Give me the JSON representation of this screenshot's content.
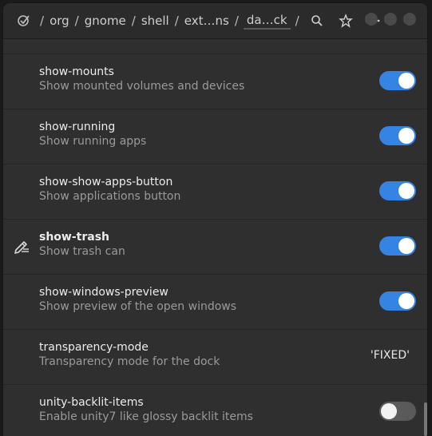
{
  "header": {
    "breadcrumbs": [
      "org",
      "gnome",
      "shell",
      "ext…ns",
      "da…ck"
    ],
    "separator": "/"
  },
  "settings": [
    {
      "name": "",
      "description": "",
      "type": "partial"
    },
    {
      "name": "show-mounts",
      "description": "Show mounted volumes and devices",
      "type": "toggle",
      "value": true
    },
    {
      "name": "show-running",
      "description": "Show running apps",
      "type": "toggle",
      "value": true
    },
    {
      "name": "show-show-apps-button",
      "description": "Show applications button",
      "type": "toggle",
      "value": true
    },
    {
      "name": "show-trash",
      "description": "Show trash can",
      "type": "toggle",
      "value": true,
      "modified": true
    },
    {
      "name": "show-windows-preview",
      "description": "Show preview of the open windows",
      "type": "toggle",
      "value": true
    },
    {
      "name": "transparency-mode",
      "description": "Transparency mode for the dock",
      "type": "enum",
      "value": "'FIXED'"
    },
    {
      "name": "unity-backlit-items",
      "description": "Enable unity7 like glossy backlit items",
      "type": "toggle",
      "value": false
    }
  ],
  "colors": {
    "accent": "#3584e4",
    "background": "#2f2f2f",
    "header": "#2b2b2b"
  }
}
